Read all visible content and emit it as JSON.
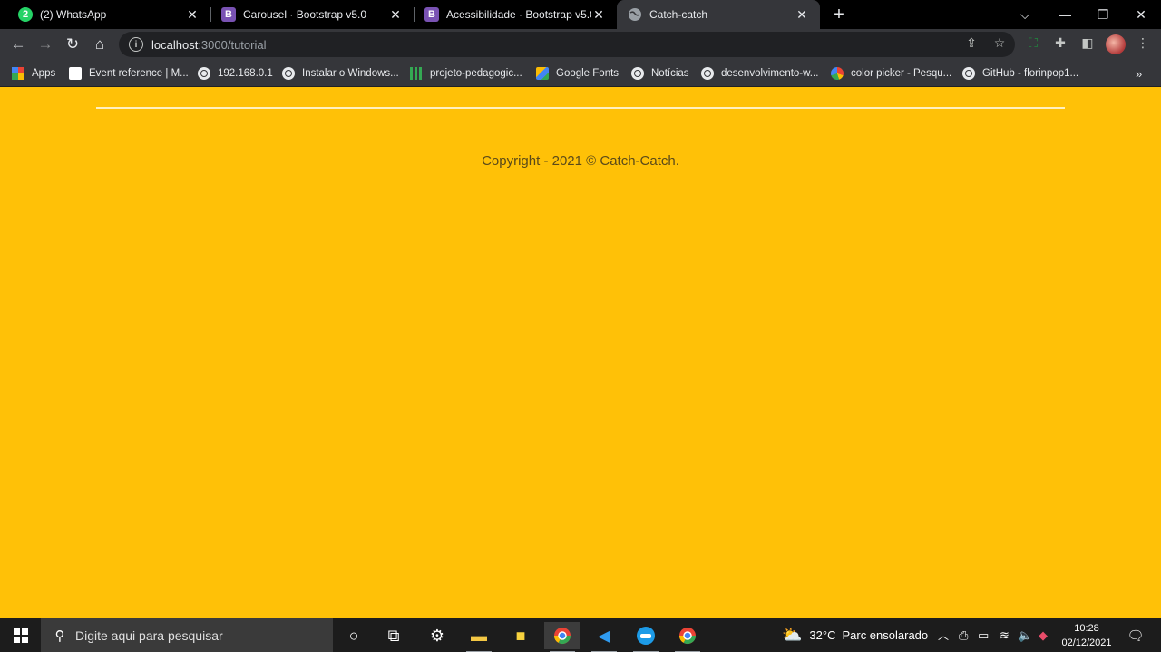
{
  "tabs": [
    {
      "title": "(2) WhatsApp",
      "favicon": "whatsapp-icon",
      "badge": "2",
      "color": "#25d366"
    },
    {
      "title": "Carousel · Bootstrap v5.0",
      "favicon": "bootstrap-icon",
      "letter": "B",
      "color": "#7952b3"
    },
    {
      "title": "Acessibilidade · Bootstrap v5.0",
      "favicon": "bootstrap-icon",
      "letter": "B",
      "color": "#7952b3"
    },
    {
      "title": "Catch-catch",
      "favicon": "globe-icon",
      "active": true
    }
  ],
  "address": {
    "host": "localhost",
    "path": ":3000/tutorial"
  },
  "bookmarks": [
    {
      "label": "Apps",
      "icon": "apps-grid-icon"
    },
    {
      "label": "Event reference | M...",
      "icon": "mdn-icon"
    },
    {
      "label": "192.168.0.1",
      "icon": "globe-icon"
    },
    {
      "label": "Instalar o Windows...",
      "icon": "globe-icon"
    },
    {
      "label": "projeto-pedagogic...",
      "icon": "grid-icon"
    },
    {
      "label": "Google Fonts",
      "icon": "google-fonts-icon"
    },
    {
      "label": "Notícias",
      "icon": "globe-icon"
    },
    {
      "label": "desenvolvimento-w...",
      "icon": "globe-icon"
    },
    {
      "label": "color picker - Pesqu...",
      "icon": "google-icon"
    },
    {
      "label": "GitHub - florinpop1...",
      "icon": "globe-icon"
    }
  ],
  "page": {
    "background": "#ffc107",
    "copyright": "Copyright - 2021 © Catch-Catch."
  },
  "taskbar": {
    "search_placeholder": "Digite aqui para pesquisar",
    "weather_temp": "32°C",
    "weather_desc": "Parc ensolarado",
    "time": "10:28",
    "date": "02/12/2021"
  }
}
